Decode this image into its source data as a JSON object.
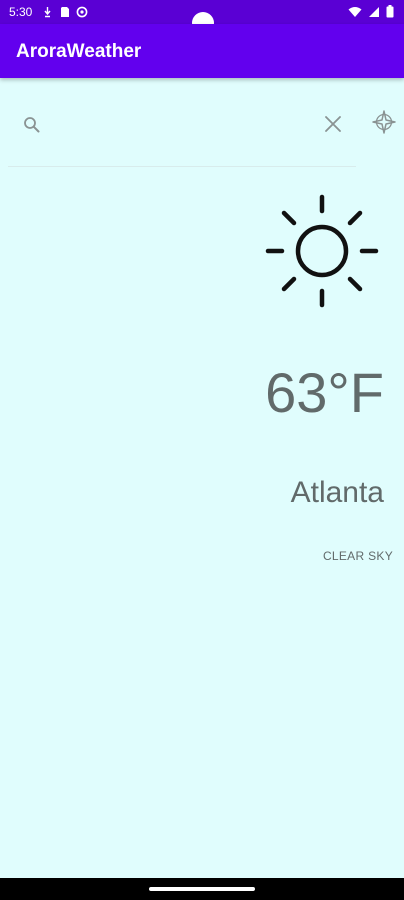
{
  "status_bar": {
    "time": "5:30",
    "left_icons": [
      "download-icon",
      "sim-card-icon",
      "settings-icon"
    ],
    "right_icons": [
      "wifi-icon",
      "signal-icon",
      "battery-icon"
    ],
    "bg_color": "#5a00d4"
  },
  "app_bar": {
    "title": "AroraWeather",
    "bg_color": "#6200ee"
  },
  "search": {
    "value": "",
    "placeholder": ""
  },
  "weather": {
    "icon": "sun-icon",
    "temperature": "63°F",
    "city": "Atlanta",
    "condition": "CLEAR SKY"
  },
  "colors": {
    "background": "#e0fdfd",
    "text": "#616a6a"
  }
}
